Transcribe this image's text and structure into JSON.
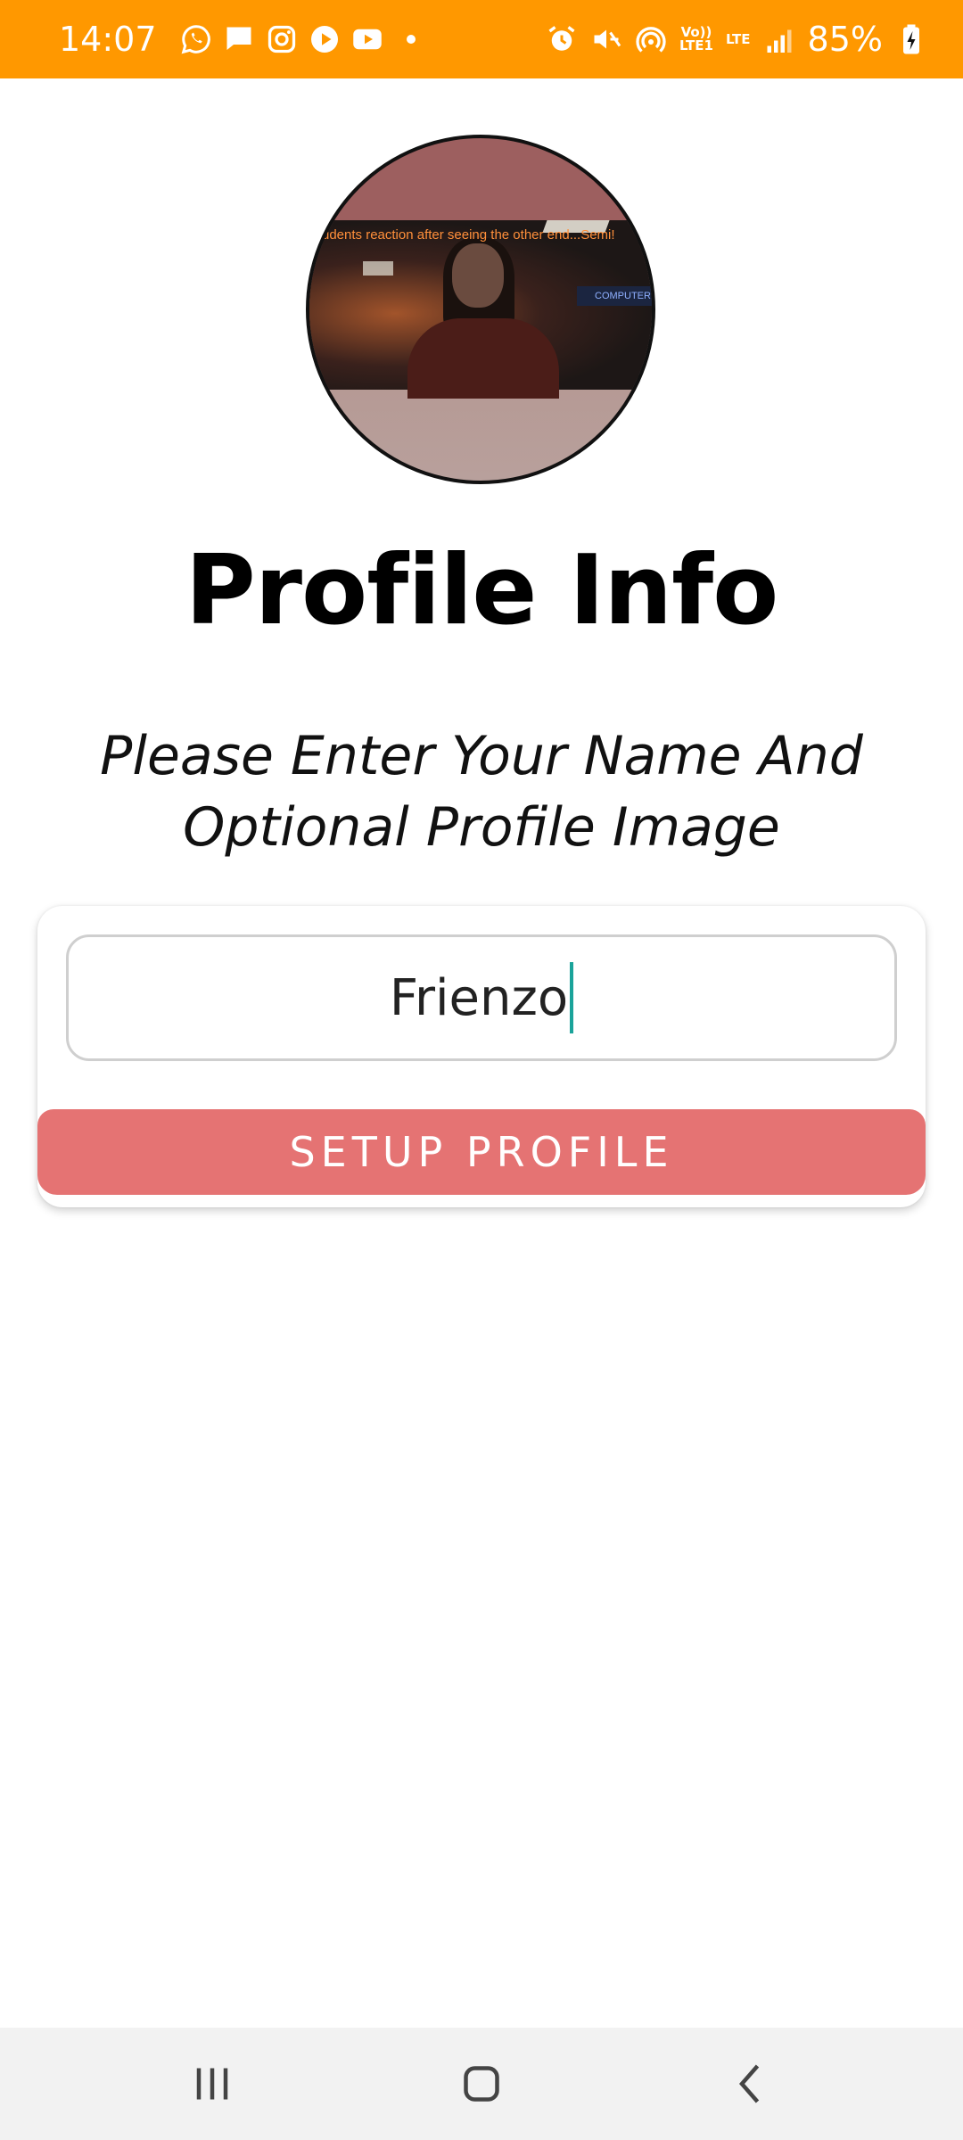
{
  "status_bar": {
    "time": "14:07",
    "battery": "85%",
    "network_top": "Vo))",
    "network_bottom": "LTE1",
    "lte_label": "LTE",
    "background_color": "#FF9800",
    "left_icons": [
      "whatsapp-icon",
      "message-icon",
      "instagram-icon",
      "play-icon",
      "youtube-icon"
    ],
    "right_icons": [
      "alarm-icon",
      "mute-icon",
      "hotspot-icon",
      "signal-icon",
      "battery-charging-icon"
    ]
  },
  "profile": {
    "avatar_caption": "udents reaction after seeing the other end...Semi!",
    "avatar_sign_text": "COMPUTER",
    "title": "Profile Info",
    "subtitle": "Please Enter Your Name And Optional Profile Image",
    "name_value": "Frienzo",
    "setup_button_label": "SETUP PROFILE",
    "button_color": "#E57373"
  },
  "nav_bar": {
    "icons": [
      "recent-apps-icon",
      "home-icon",
      "back-icon"
    ]
  }
}
